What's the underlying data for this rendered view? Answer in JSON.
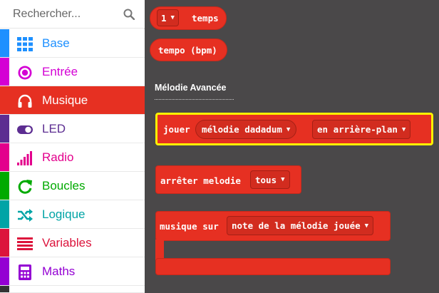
{
  "search": {
    "placeholder": "Rechercher..."
  },
  "sidebar": {
    "items": [
      {
        "label": "Base",
        "color": "#1e90ff",
        "icon": "grid-icon"
      },
      {
        "label": "Entrée",
        "color": "#d400d4",
        "icon": "radio-button-icon"
      },
      {
        "label": "Musique",
        "color": "#e63022",
        "icon": "headphones-icon",
        "active": true
      },
      {
        "label": "LED",
        "color": "#5c2d91",
        "icon": "toggle-icon"
      },
      {
        "label": "Radio",
        "color": "#e3008c",
        "icon": "signal-bars-icon"
      },
      {
        "label": "Boucles",
        "color": "#00aa00",
        "icon": "refresh-icon"
      },
      {
        "label": "Logique",
        "color": "#00a4a6",
        "icon": "shuffle-icon"
      },
      {
        "label": "Variables",
        "color": "#dc143c",
        "icon": "list-icon"
      },
      {
        "label": "Maths",
        "color": "#9400d3",
        "icon": "calculator-icon"
      }
    ]
  },
  "workspace": {
    "blocks": {
      "beats": {
        "value": "1",
        "text": "temps"
      },
      "tempo": {
        "text": "tempo (bpm)"
      }
    },
    "section_title": "Mélodie Avancée",
    "play": {
      "label": "jouer",
      "melody": "mélodie dadadum",
      "mode": "en arrière-plan"
    },
    "stop": {
      "label": "arrêter melodie",
      "option": "tous"
    },
    "on_music": {
      "label": "musique sur",
      "event": "note de la mélodie jouée"
    }
  },
  "colors": {
    "music": "#e63022",
    "workspace_bg": "#4a4849",
    "highlight": "#fff200"
  }
}
